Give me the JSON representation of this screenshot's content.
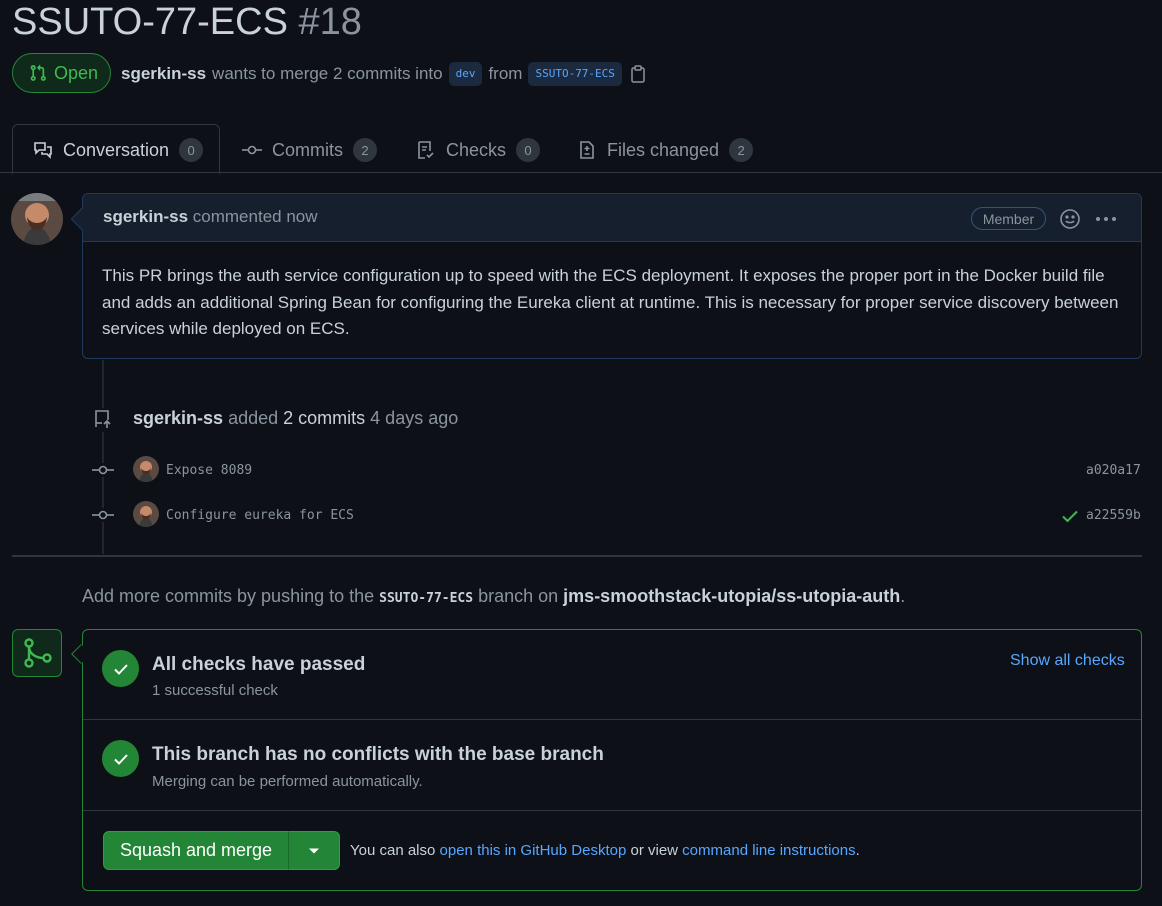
{
  "pr": {
    "title": "SSUTO-77-ECS",
    "number": "#18",
    "state": "Open",
    "author": "sgerkin-ss",
    "merge_text": "wants to merge 2 commits into",
    "base_branch": "dev",
    "from_text": "from",
    "head_branch": "SSUTO-77-ECS"
  },
  "tabs": [
    {
      "label": "Conversation",
      "count": "0"
    },
    {
      "label": "Commits",
      "count": "2"
    },
    {
      "label": "Checks",
      "count": "0"
    },
    {
      "label": "Files changed",
      "count": "2"
    }
  ],
  "comment": {
    "author": "sgerkin-ss",
    "time": "commented now",
    "badge": "Member",
    "body": "This PR brings the auth service configuration up to speed with the ECS deployment. It exposes the proper port in the Docker build file and adds an additional Spring Bean for configuring the Eureka client at runtime. This is necessary for proper service discovery between services while deployed on ECS."
  },
  "push_event": {
    "author": "sgerkin-ss",
    "action": "added",
    "count": "2 commits",
    "time": "4 days ago"
  },
  "commits": [
    {
      "message": "Expose 8089",
      "sha": "a020a17"
    },
    {
      "message": "Configure eureka for ECS",
      "sha": "a22559b"
    }
  ],
  "add_more": {
    "prefix": "Add more commits by pushing to the",
    "branch": "SSUTO-77-ECS",
    "middle": "branch on",
    "repo": "jms-smoothstack-utopia/ss-utopia-auth",
    "suffix": "."
  },
  "merge_box": {
    "checks_title": "All checks have passed",
    "checks_sub": "1 successful check",
    "show_all": "Show all checks",
    "conflicts_title": "This branch has no conflicts with the base branch",
    "conflicts_sub": "Merging can be performed automatically.",
    "button": "Squash and merge",
    "also_prefix": "You can also",
    "desktop_link": "open this in GitHub Desktop",
    "also_middle": "or view",
    "cli_link": "command line instructions",
    "also_suffix": "."
  },
  "colors": {
    "accent_green": "#238636",
    "link_blue": "#58a6ff",
    "background": "#0d1117"
  }
}
